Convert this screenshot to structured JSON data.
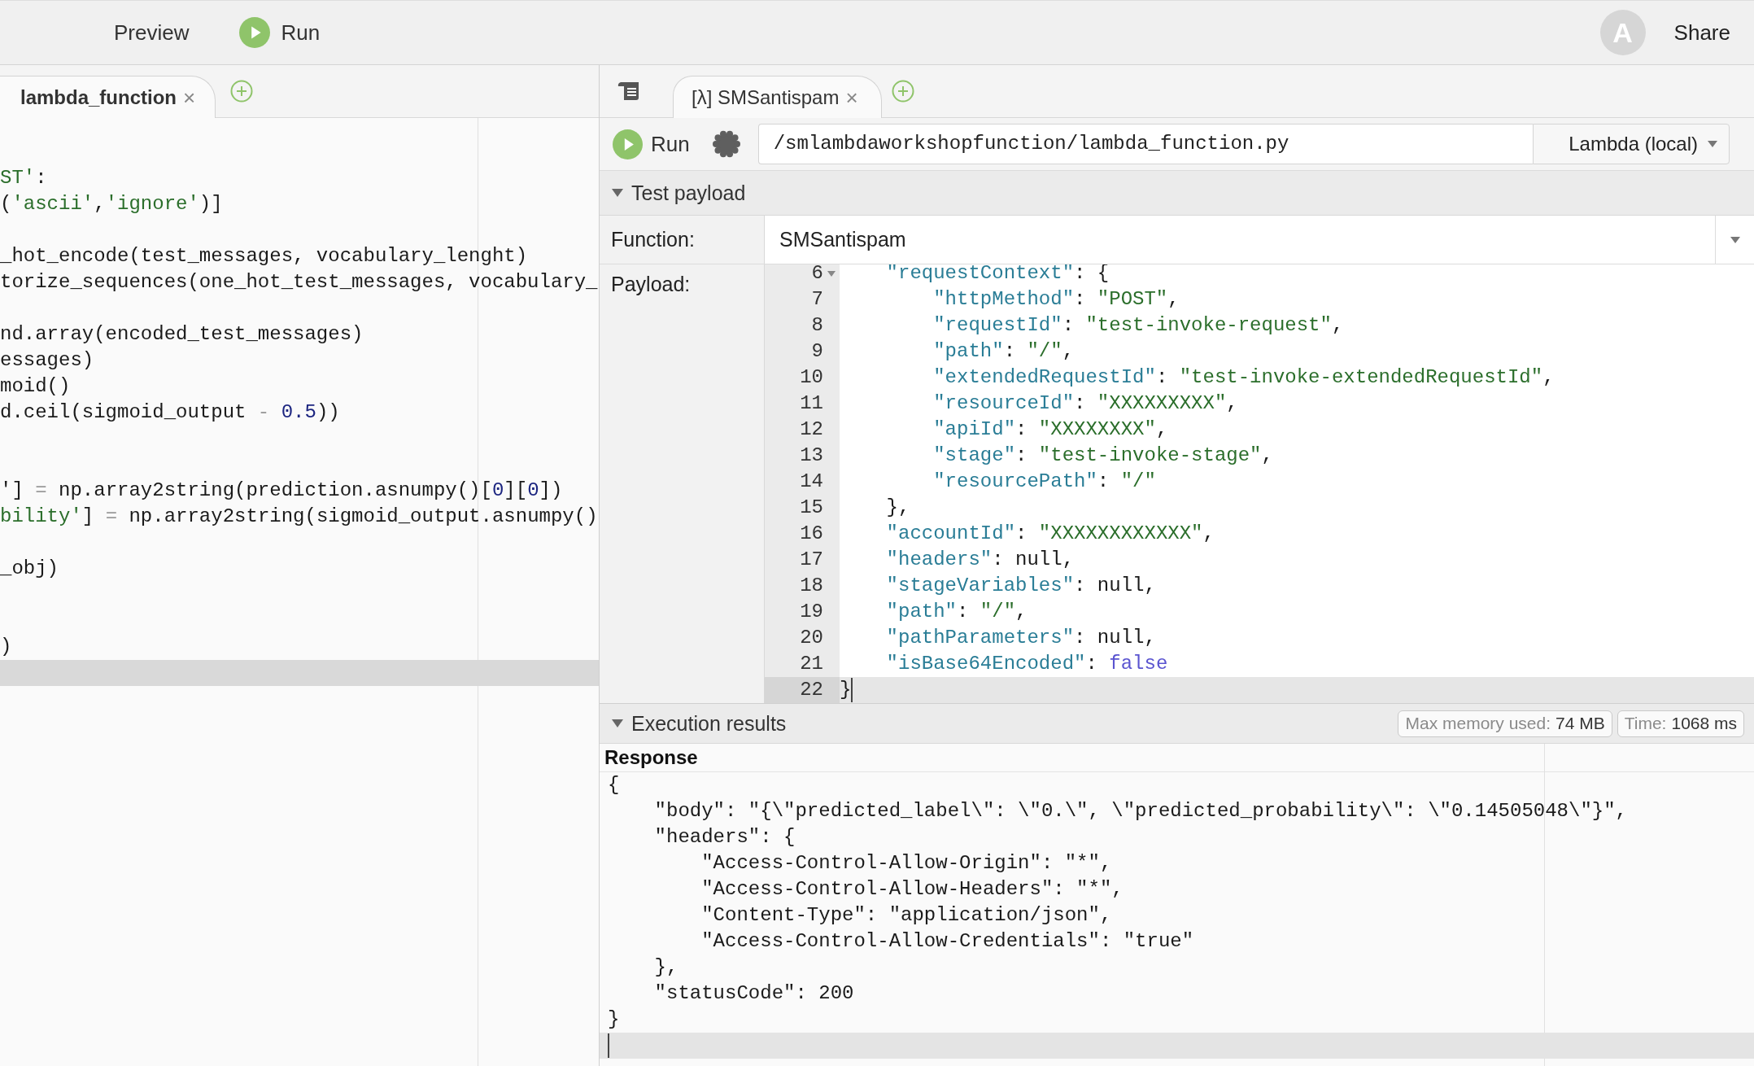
{
  "top_bar": {
    "preview": "Preview",
    "run": "Run",
    "avatar": "A",
    "share": "Share"
  },
  "left_pane": {
    "tabs": [
      {
        "label": "lambda_function",
        "close": "×",
        "selected": true
      }
    ],
    "editor": {
      "focused": false,
      "lines": [
        {
          "tokens": [
            {
              "text": "ST'",
              "kind": "string"
            },
            {
              "text": ":",
              "kind": "plain"
            }
          ],
          "current": false
        },
        {
          "tokens": [
            {
              "text": "(",
              "kind": "plain"
            },
            {
              "text": "'ascii'",
              "kind": "string"
            },
            {
              "text": ",",
              "kind": "plain"
            },
            {
              "text": "'ignore'",
              "kind": "string"
            },
            {
              "text": ")]",
              "kind": "plain"
            }
          ],
          "current": false
        },
        {
          "current": false
        },
        {
          "tokens": [
            {
              "text": "_hot_encode(test_messages, vocabulary_lenght)",
              "kind": "plain"
            }
          ],
          "current": false
        },
        {
          "tokens": [
            {
              "text": "torize_sequences(one_hot_test_messages, vocabulary_",
              "kind": "plain"
            }
          ],
          "current": false
        },
        {
          "current": false
        },
        {
          "tokens": [
            {
              "text": "nd.array(encoded_test_messages)",
              "kind": "plain"
            }
          ],
          "current": false
        },
        {
          "tokens": [
            {
              "text": "essages)",
              "kind": "plain"
            }
          ],
          "current": false
        },
        {
          "tokens": [
            {
              "text": "moid()",
              "kind": "plain"
            }
          ],
          "current": false
        },
        {
          "tokens": [
            {
              "text": "d.ceil(sigmoid_output ",
              "kind": "plain"
            },
            {
              "text": "- ",
              "kind": "op"
            },
            {
              "text": "0.5",
              "kind": "number"
            },
            {
              "text": "))",
              "kind": "plain"
            }
          ],
          "current": false
        },
        {
          "current": false
        },
        {
          "current": false
        },
        {
          "tokens": [
            {
              "text": "'] ",
              "kind": "plain"
            },
            {
              "text": "=",
              "kind": "op"
            },
            {
              "text": " np.array2string(prediction.asnumpy()[",
              "kind": "plain"
            },
            {
              "text": "0",
              "kind": "number"
            },
            {
              "text": "][",
              "kind": "plain"
            },
            {
              "text": "0",
              "kind": "number"
            },
            {
              "text": "])",
              "kind": "plain"
            }
          ],
          "current": false
        },
        {
          "tokens": [
            {
              "text": "bility'",
              "kind": "string"
            },
            {
              "text": "] ",
              "kind": "plain"
            },
            {
              "text": "=",
              "kind": "op"
            },
            {
              "text": " np.array2string(sigmoid_output.asnumpy()",
              "kind": "plain"
            }
          ],
          "current": false
        },
        {
          "current": false
        },
        {
          "tokens": [
            {
              "text": "_obj)",
              "kind": "plain"
            }
          ],
          "current": false
        },
        {
          "current": false
        },
        {
          "current": false
        },
        {
          "tokens": [
            {
              "text": ")",
              "kind": "plain"
            }
          ],
          "current": false
        },
        {
          "current": true
        }
      ]
    }
  },
  "right_pane": {
    "tabs": [
      {
        "label": "[λ] SMSantispam",
        "close": "×",
        "selected": true
      }
    ],
    "toolbar": {
      "run": "Run",
      "path": "/smlambdaworkshopfunction/lambda_function.py",
      "runtime": "Lambda (local)"
    },
    "test_payload": {
      "title": "Test payload",
      "expanded": true,
      "function_label": "Function:",
      "function": "SMSantispam",
      "payload_label": "Payload:",
      "editor": {
        "focused": true,
        "lines": [
          {
            "children": [
              {
                "number": "6",
                "foldable": true,
                "current": false,
                "tokens": [
                  {
                    "text": "\"requestContext\"",
                    "kind": "key"
                  },
                  {
                    "text": ": {",
                    "kind": "plain"
                  }
                ],
                "children": [
                  {
                    "number": "7",
                    "foldable": false,
                    "current": false,
                    "tokens": [
                      {
                        "text": "\"httpMethod\"",
                        "kind": "key"
                      },
                      {
                        "text": ": ",
                        "kind": "plain"
                      },
                      {
                        "text": "\"POST\"",
                        "kind": "string"
                      },
                      {
                        "text": ",",
                        "kind": "plain"
                      }
                    ]
                  },
                  {
                    "number": "8",
                    "foldable": false,
                    "current": false,
                    "tokens": [
                      {
                        "text": "\"requestId\"",
                        "kind": "key"
                      },
                      {
                        "text": ": ",
                        "kind": "plain"
                      },
                      {
                        "text": "\"test-invoke-request\"",
                        "kind": "string"
                      },
                      {
                        "text": ",",
                        "kind": "plain"
                      }
                    ]
                  },
                  {
                    "number": "9",
                    "foldable": false,
                    "current": false,
                    "tokens": [
                      {
                        "text": "\"path\"",
                        "kind": "key"
                      },
                      {
                        "text": ": ",
                        "kind": "plain"
                      },
                      {
                        "text": "\"/\"",
                        "kind": "string"
                      },
                      {
                        "text": ",",
                        "kind": "plain"
                      }
                    ]
                  },
                  {
                    "number": "10",
                    "foldable": false,
                    "current": false,
                    "tokens": [
                      {
                        "text": "\"extendedRequestId\"",
                        "kind": "key"
                      },
                      {
                        "text": ": ",
                        "kind": "plain"
                      },
                      {
                        "text": "\"test-invoke-extendedRequestId\"",
                        "kind": "string"
                      },
                      {
                        "text": ",",
                        "kind": "plain"
                      }
                    ]
                  },
                  {
                    "number": "11",
                    "foldable": false,
                    "current": false,
                    "tokens": [
                      {
                        "text": "\"resourceId\"",
                        "kind": "key"
                      },
                      {
                        "text": ": ",
                        "kind": "plain"
                      },
                      {
                        "text": "\"XXXXXXXXX\"",
                        "kind": "string"
                      },
                      {
                        "text": ",",
                        "kind": "plain"
                      }
                    ]
                  },
                  {
                    "number": "12",
                    "foldable": false,
                    "current": false,
                    "tokens": [
                      {
                        "text": "\"apiId\"",
                        "kind": "key"
                      },
                      {
                        "text": ": ",
                        "kind": "plain"
                      },
                      {
                        "text": "\"XXXXXXXX\"",
                        "kind": "string"
                      },
                      {
                        "text": ",",
                        "kind": "plain"
                      }
                    ]
                  },
                  {
                    "number": "13",
                    "foldable": false,
                    "current": false,
                    "tokens": [
                      {
                        "text": "\"stage\"",
                        "kind": "key"
                      },
                      {
                        "text": ": ",
                        "kind": "plain"
                      },
                      {
                        "text": "\"test-invoke-stage\"",
                        "kind": "string"
                      },
                      {
                        "text": ",",
                        "kind": "plain"
                      }
                    ]
                  },
                  {
                    "number": "14",
                    "foldable": false,
                    "current": false,
                    "tokens": [
                      {
                        "text": "\"resourcePath\"",
                        "kind": "key"
                      },
                      {
                        "text": ": ",
                        "kind": "plain"
                      },
                      {
                        "text": "\"/\"",
                        "kind": "string"
                      }
                    ]
                  }
                ]
              },
              {
                "number": "15",
                "foldable": false,
                "current": false,
                "tokens": [
                  {
                    "text": "},",
                    "kind": "plain"
                  }
                ]
              },
              {
                "number": "16",
                "foldable": false,
                "current": false,
                "tokens": [
                  {
                    "text": "\"accountId\"",
                    "kind": "key"
                  },
                  {
                    "text": ": ",
                    "kind": "plain"
                  },
                  {
                    "text": "\"XXXXXXXXXXXX\"",
                    "kind": "string"
                  },
                  {
                    "text": ",",
                    "kind": "plain"
                  }
                ]
              },
              {
                "number": "17",
                "foldable": false,
                "current": false,
                "tokens": [
                  {
                    "text": "\"headers\"",
                    "kind": "key"
                  },
                  {
                    "text": ": null,",
                    "kind": "plain"
                  }
                ]
              },
              {
                "number": "18",
                "foldable": false,
                "current": false,
                "tokens": [
                  {
                    "text": "\"stageVariables\"",
                    "kind": "key"
                  },
                  {
                    "text": ": null,",
                    "kind": "plain"
                  }
                ]
              },
              {
                "number": "19",
                "foldable": false,
                "current": false,
                "tokens": [
                  {
                    "text": "\"path\"",
                    "kind": "key"
                  },
                  {
                    "text": ": ",
                    "kind": "plain"
                  },
                  {
                    "text": "\"/\"",
                    "kind": "string"
                  },
                  {
                    "text": ",",
                    "kind": "plain"
                  }
                ]
              },
              {
                "number": "20",
                "foldable": false,
                "current": false,
                "tokens": [
                  {
                    "text": "\"pathParameters\"",
                    "kind": "key"
                  },
                  {
                    "text": ": null,",
                    "kind": "plain"
                  }
                ]
              },
              {
                "number": "21",
                "foldable": false,
                "current": false,
                "tokens": [
                  {
                    "text": "\"isBase64Encoded\"",
                    "kind": "key"
                  },
                  {
                    "text": ": ",
                    "kind": "plain"
                  },
                  {
                    "text": "false",
                    "kind": "keyword"
                  }
                ]
              }
            ]
          },
          {
            "number": "22",
            "foldable": false,
            "current": true,
            "tokens": [
              {
                "text": "}",
                "kind": "plain"
              }
            ]
          }
        ]
      }
    },
    "execution_results": {
      "title": "Execution results",
      "expanded": true,
      "stats": [
        {
          "label": "Max memory used:",
          "value": "74 MB"
        },
        {
          "label": "Time:",
          "value": "1068 ms"
        }
      ],
      "response_title": "Response",
      "response": {
        "focused": true,
        "lines": [
          {
            "text": "{",
            "current": false,
            "children": [
              {
                "text": "\"body\": \"{\\\"predicted_label\\\": \\\"0.\\\", \\\"predicted_probability\\\": \\\"0.14505048\\\"}\",",
                "current": false
              },
              {
                "text": "\"headers\": {",
                "current": false,
                "children": [
                  {
                    "text": "\"Access-Control-Allow-Origin\": \"*\",",
                    "current": false
                  },
                  {
                    "text": "\"Access-Control-Allow-Headers\": \"*\",",
                    "current": false
                  },
                  {
                    "text": "\"Content-Type\": \"application/json\",",
                    "current": false
                  },
                  {
                    "text": "\"Access-Control-Allow-Credentials\": \"true\"",
                    "current": false
                  }
                ]
              },
              {
                "text": "},",
                "current": false
              },
              {
                "text": "\"statusCode\": 200",
                "current": false
              }
            ]
          },
          {
            "text": "}",
            "current": false
          },
          {
            "current": true
          }
        ]
      }
    }
  }
}
